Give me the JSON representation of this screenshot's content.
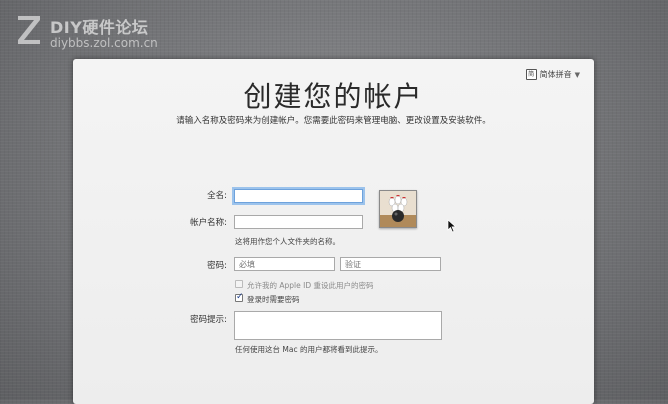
{
  "watermark": {
    "brand": "DIY硬件论坛",
    "url": "diybbs.zol.com.cn"
  },
  "header": {
    "input_method_icon": "简",
    "input_method_label": "简体拼音",
    "dropdown_arrow": "▼"
  },
  "page": {
    "title": "创建您的帐户",
    "subtitle": "请输入名称及密码来为创建帐户。您需要此密码来管理电脑、更改设置及安装软件。"
  },
  "form": {
    "full_name_label": "全名:",
    "full_name_value": "",
    "account_name_label": "帐户名称:",
    "account_name_value": "",
    "account_note": "这将用作您个人文件夹的名称。",
    "password_label": "密码:",
    "password_placeholder": "必填",
    "verify_placeholder": "验证",
    "allow_apple_id_label": "允许我的 Apple ID 重设此用户的密码",
    "allow_apple_id_checked": false,
    "require_password_label": "登录时需要密码",
    "require_password_checked": true,
    "hint_label": "密码提示:",
    "hint_value": "",
    "hint_note": "任何使用这台 Mac 的用户都将看到此提示。"
  },
  "avatar": {
    "icon": "bowling-icon"
  },
  "colors": {
    "background": "#6f7073",
    "panel": "#f0f0f0",
    "focus_ring": "#9cc3ec",
    "checkmark": "#1e3f8a"
  }
}
